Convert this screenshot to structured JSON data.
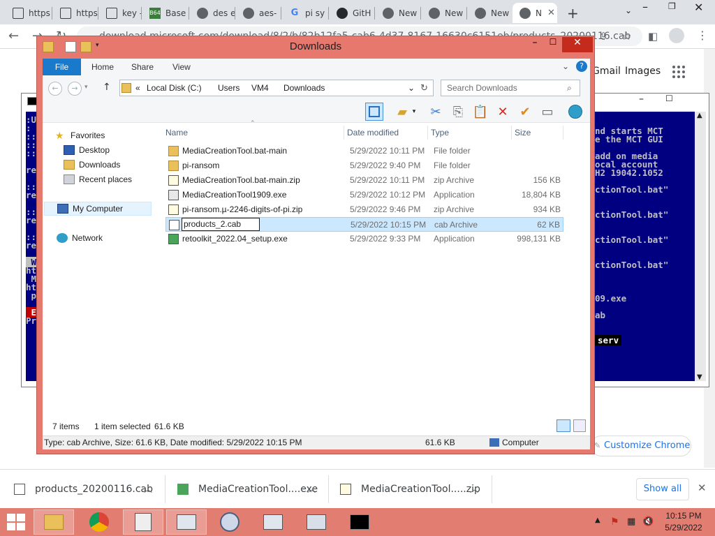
{
  "browser": {
    "tabs": [
      {
        "label": "https",
        "icon": "generic-doc-icon"
      },
      {
        "label": "https",
        "icon": "generic-doc-icon"
      },
      {
        "label": "key -",
        "icon": "generic-doc-icon"
      },
      {
        "label": "Base",
        "icon": "base64-icon"
      },
      {
        "label": "des e",
        "icon": "globe-icon"
      },
      {
        "label": "aes-",
        "icon": "globe-icon"
      },
      {
        "label": "pi sy",
        "icon": "google-icon"
      },
      {
        "label": "GitH",
        "icon": "github-icon"
      },
      {
        "label": "New",
        "icon": "chrome-icon"
      },
      {
        "label": "New",
        "icon": "chrome-icon"
      },
      {
        "label": "New",
        "icon": "chrome-icon"
      },
      {
        "label": "N",
        "icon": "chrome-icon",
        "active": true
      }
    ],
    "url": "download.microsoft.com/download/8/2/b/82b12fa5-cab6-4d37-8167-16630c6151eb/products_20200116.cab",
    "page_links": {
      "gmail": "Gmail",
      "images": "Images"
    },
    "customize_label": "Customize Chrome"
  },
  "console": {
    "left_lines": [
      ":U",
      ":",
      "::",
      "::",
      "::",
      "",
      "re",
      "",
      "::",
      "re",
      "",
      "::",
      "re",
      "",
      "::",
      "re",
      "",
      " W",
      "ht",
      " M",
      "ht",
      " p",
      "",
      " E",
      "Pr"
    ],
    "right_lines": [
      {
        "row": 0,
        "text": "nd starts MCT"
      },
      {
        "row": 1,
        "text": "e the MCT GUI"
      },
      {
        "row": 3,
        "text": "add on media"
      },
      {
        "row": 4,
        "text": "ocal account"
      },
      {
        "row": 5,
        "text": "H2 19042.1052"
      },
      {
        "row": 7,
        "text": "ctionTool.bat\""
      },
      {
        "row": 10,
        "text": "ctionTool.bat\""
      },
      {
        "row": 13,
        "text": "ctionTool.bat\""
      },
      {
        "row": 16,
        "text": "ctionTool.bat\""
      },
      {
        "row": 20,
        "text": "09.exe"
      },
      {
        "row": 22,
        "text": "ab"
      },
      {
        "row": 25,
        "text": "serv"
      }
    ]
  },
  "explorer": {
    "title": "Downloads",
    "ribbon_tabs": [
      "File",
      "Home",
      "Share",
      "View"
    ],
    "breadcrumb": [
      "«",
      "Local Disk (C:)",
      "›",
      "Users",
      "›",
      "VM4",
      "›",
      "Downloads"
    ],
    "search_placeholder": "Search Downloads",
    "nav": {
      "favorites": "Favorites",
      "desktop": "Desktop",
      "downloads": "Downloads",
      "recent": "Recent places",
      "computer": "My Computer",
      "network": "Network"
    },
    "columns": [
      "Name",
      "Date modified",
      "Type",
      "Size"
    ],
    "files": [
      {
        "name": "MediaCreationTool.bat-main",
        "date": "5/29/2022 10:11 PM",
        "type": "File folder",
        "size": "",
        "icon": "folder-icon"
      },
      {
        "name": "pi-ransom",
        "date": "5/29/2022 9:40 PM",
        "type": "File folder",
        "size": "",
        "icon": "folder-icon"
      },
      {
        "name": "MediaCreationTool.bat-main.zip",
        "date": "5/29/2022 10:11 PM",
        "type": "zip Archive",
        "size": "156 KB",
        "icon": "zip-icon"
      },
      {
        "name": "MediaCreationTool1909.exe",
        "date": "5/29/2022 10:12 PM",
        "type": "Application",
        "size": "18,804 KB",
        "icon": "setup-icon"
      },
      {
        "name": "pi-ransom.µ-2246-digits-of-pi.zip",
        "date": "5/29/2022 9:46 PM",
        "type": "zip Archive",
        "size": "934 KB",
        "icon": "zip-icon"
      },
      {
        "name": "products_2.cab",
        "date": "5/29/2022 10:15 PM",
        "type": "cab Archive",
        "size": "62 KB",
        "icon": "cab-icon",
        "selected": true,
        "renaming": true
      },
      {
        "name": "retoolkit_2022.04_setup.exe",
        "date": "5/29/2022 9:33 PM",
        "type": "Application",
        "size": "998,131 KB",
        "icon": "installer-icon"
      }
    ],
    "status": {
      "count": "7 items",
      "selected": "1 item selected",
      "selected_size": "61.6 KB"
    },
    "details_bar": {
      "info": "Type: cab Archive, Size: 61.6 KB, Date modified: 5/29/2022 10:15 PM",
      "size": "61.6 KB",
      "location": "Computer"
    }
  },
  "downloads_bar": {
    "items": [
      {
        "label": "products_20200116.cab",
        "icon": "cab-icon"
      },
      {
        "label": "MediaCreationTool....exe",
        "icon": "setup-icon"
      },
      {
        "label": "MediaCreationTool.....zip",
        "icon": "zip-icon"
      }
    ],
    "show_all": "Show all"
  },
  "taskbar": {
    "time": "10:15 PM",
    "date": "5/29/2022",
    "apps": [
      "explorer-icon",
      "chrome-icon",
      "notepad-icon",
      "window-icon",
      "shield-icon",
      "window-icon",
      "monitor-icon",
      "cmd-icon"
    ]
  },
  "colors": {
    "explorer_frame": "#e6786e",
    "taskbar": "#e27d72",
    "console_bg": "#000080",
    "ribbon_file": "#1979ca",
    "selection": "#cce8ff"
  }
}
